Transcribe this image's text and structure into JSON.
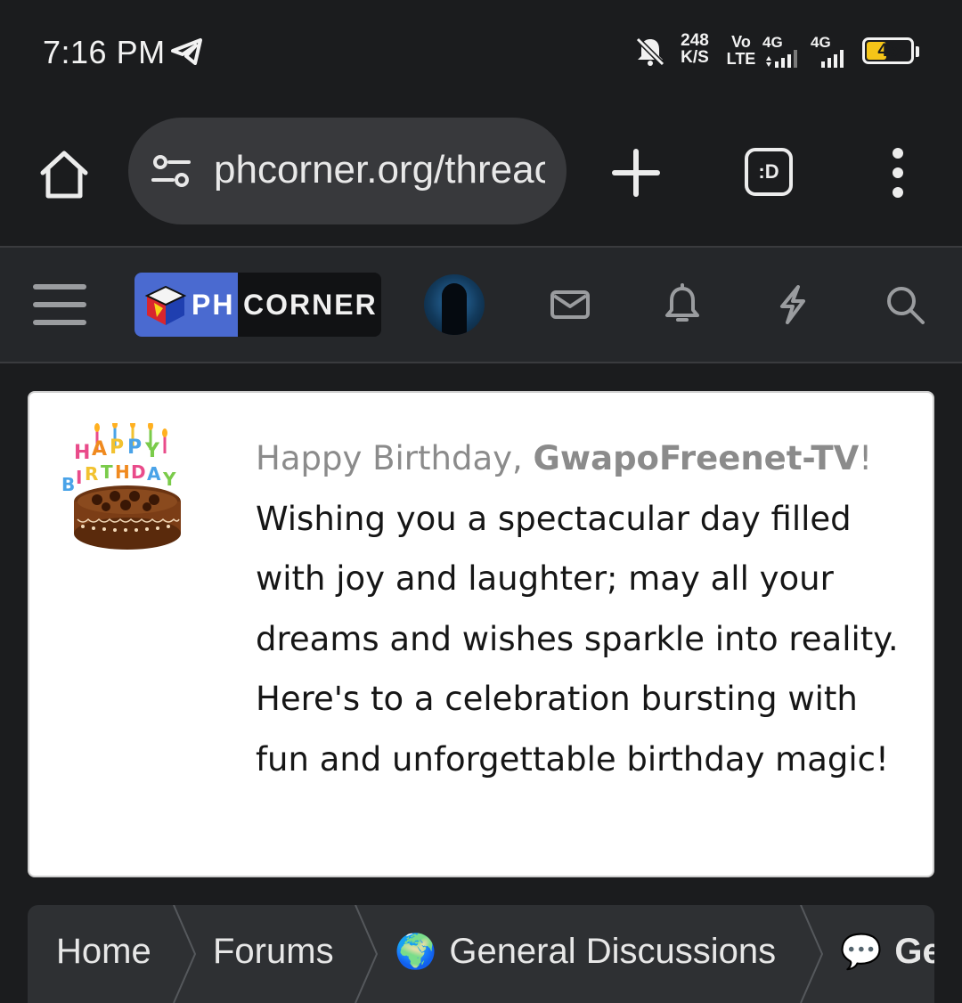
{
  "status_bar": {
    "time": "7:16 PM",
    "net_speed_value": "248",
    "net_speed_unit": "K/S",
    "volte_top": "Vo",
    "volte_bottom": "LTE",
    "sim1_label": "4G",
    "sim2_label": "4G",
    "battery_level": "45",
    "battery_fraction": 0.45,
    "icons": [
      "telegram-icon",
      "bell-off-icon",
      "signal-icon",
      "battery-icon"
    ]
  },
  "browser": {
    "url": "phcorner.org/threac",
    "tabs_label": ":D",
    "icons": [
      "home-icon",
      "site-settings-icon",
      "plus-icon",
      "more-vert-icon"
    ]
  },
  "site_header": {
    "logo_ph": "PH",
    "logo_corner": "CORNER",
    "icons": [
      "hamburger-icon",
      "envelope-icon",
      "bell-icon",
      "bolt-icon",
      "search-icon"
    ]
  },
  "birthday_notice": {
    "greeting_prefix": "Happy Birthday, ",
    "username": "GwapoFreenet-TV",
    "greeting_suffix": "!",
    "message": "Wishing you a spectacular day filled with joy and laughter; may all your dreams and wishes sparkle into reality. Here's to a celebration bursting with fun and unforgettable birthday magic!"
  },
  "breadcrumb": {
    "items": [
      {
        "label": "Home"
      },
      {
        "label": "Forums"
      },
      {
        "emoji": "🌍",
        "label": "General Discussions"
      },
      {
        "emoji": "💬",
        "label": "Ge"
      }
    ]
  },
  "colors": {
    "background": "#1b1c1e",
    "url_bar": "#38393c",
    "header": "#25272a",
    "logo_blue": "#4a6ad0",
    "battery": "#f5c518",
    "greeting_gray": "#8b8b8b",
    "breadcrumb_bg": "#2e3033"
  }
}
